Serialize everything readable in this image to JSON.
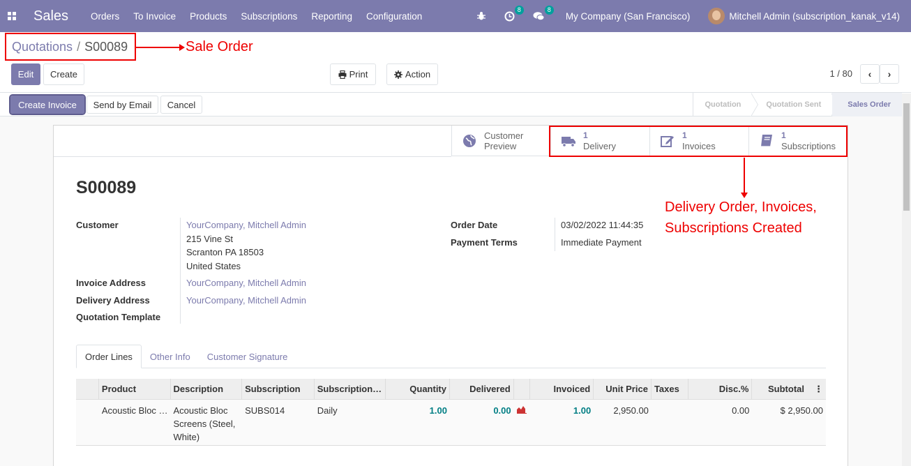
{
  "navbar": {
    "app_name": "Sales",
    "menu": [
      "Orders",
      "To Invoice",
      "Products",
      "Subscriptions",
      "Reporting",
      "Configuration"
    ],
    "activity_badge": "8",
    "message_badge": "8",
    "company": "My Company (San Francisco)",
    "user": "Mitchell Admin (subscription_kanak_v14)"
  },
  "breadcrumb": {
    "parent": "Quotations",
    "separator": "/",
    "current": "S00089"
  },
  "annotations": {
    "sale_order": "Sale Order",
    "created_line1": "Delivery Order, Invoices,",
    "created_line2": "Subscriptions Created"
  },
  "toolbar": {
    "edit": "Edit",
    "create": "Create",
    "print": "Print",
    "action": "Action",
    "pager": "1 / 80"
  },
  "actions": {
    "create_invoice": "Create Invoice",
    "send_email": "Send by Email",
    "cancel": "Cancel"
  },
  "status_steps": [
    "Quotation",
    "Quotation Sent",
    "Sales Order"
  ],
  "status_active": "Sales Order",
  "smart_buttons": {
    "preview": {
      "line1": "Customer",
      "line2": "Preview"
    },
    "delivery": {
      "count": "1",
      "label": "Delivery"
    },
    "invoices": {
      "count": "1",
      "label": "Invoices"
    },
    "subscriptions": {
      "count": "1",
      "label": "Subscriptions"
    }
  },
  "order": {
    "name": "S00089",
    "customer_label": "Customer",
    "customer": "YourCompany, Mitchell Admin",
    "address": [
      "215 Vine St",
      "Scranton PA 18503",
      "United States"
    ],
    "invoice_address_label": "Invoice Address",
    "invoice_address": "YourCompany, Mitchell Admin",
    "delivery_address_label": "Delivery Address",
    "delivery_address": "YourCompany, Mitchell Admin",
    "template_label": "Quotation Template",
    "order_date_label": "Order Date",
    "order_date": "03/02/2022 11:44:35",
    "payment_terms_label": "Payment Terms",
    "payment_terms": "Immediate Payment"
  },
  "tabs": [
    "Order Lines",
    "Other Info",
    "Customer Signature"
  ],
  "table": {
    "headers": [
      "Product",
      "Description",
      "Subscription",
      "Subscription…",
      "Quantity",
      "Delivered",
      "Invoiced",
      "Unit Price",
      "Taxes",
      "Disc.%",
      "Subtotal"
    ],
    "row": {
      "product": "Acoustic Bloc …",
      "description": "Acoustic Bloc Screens (Steel, White)",
      "subscription": "SUBS014",
      "template": "Daily",
      "quantity": "1.00",
      "delivered": "0.00",
      "invoiced": "1.00",
      "unit_price": "2,950.00",
      "taxes": "",
      "discount": "0.00",
      "subtotal": "$ 2,950.00"
    }
  },
  "colors": {
    "brand": "#7c7bad",
    "annotation": "#e00000",
    "teal": "#017e84"
  }
}
